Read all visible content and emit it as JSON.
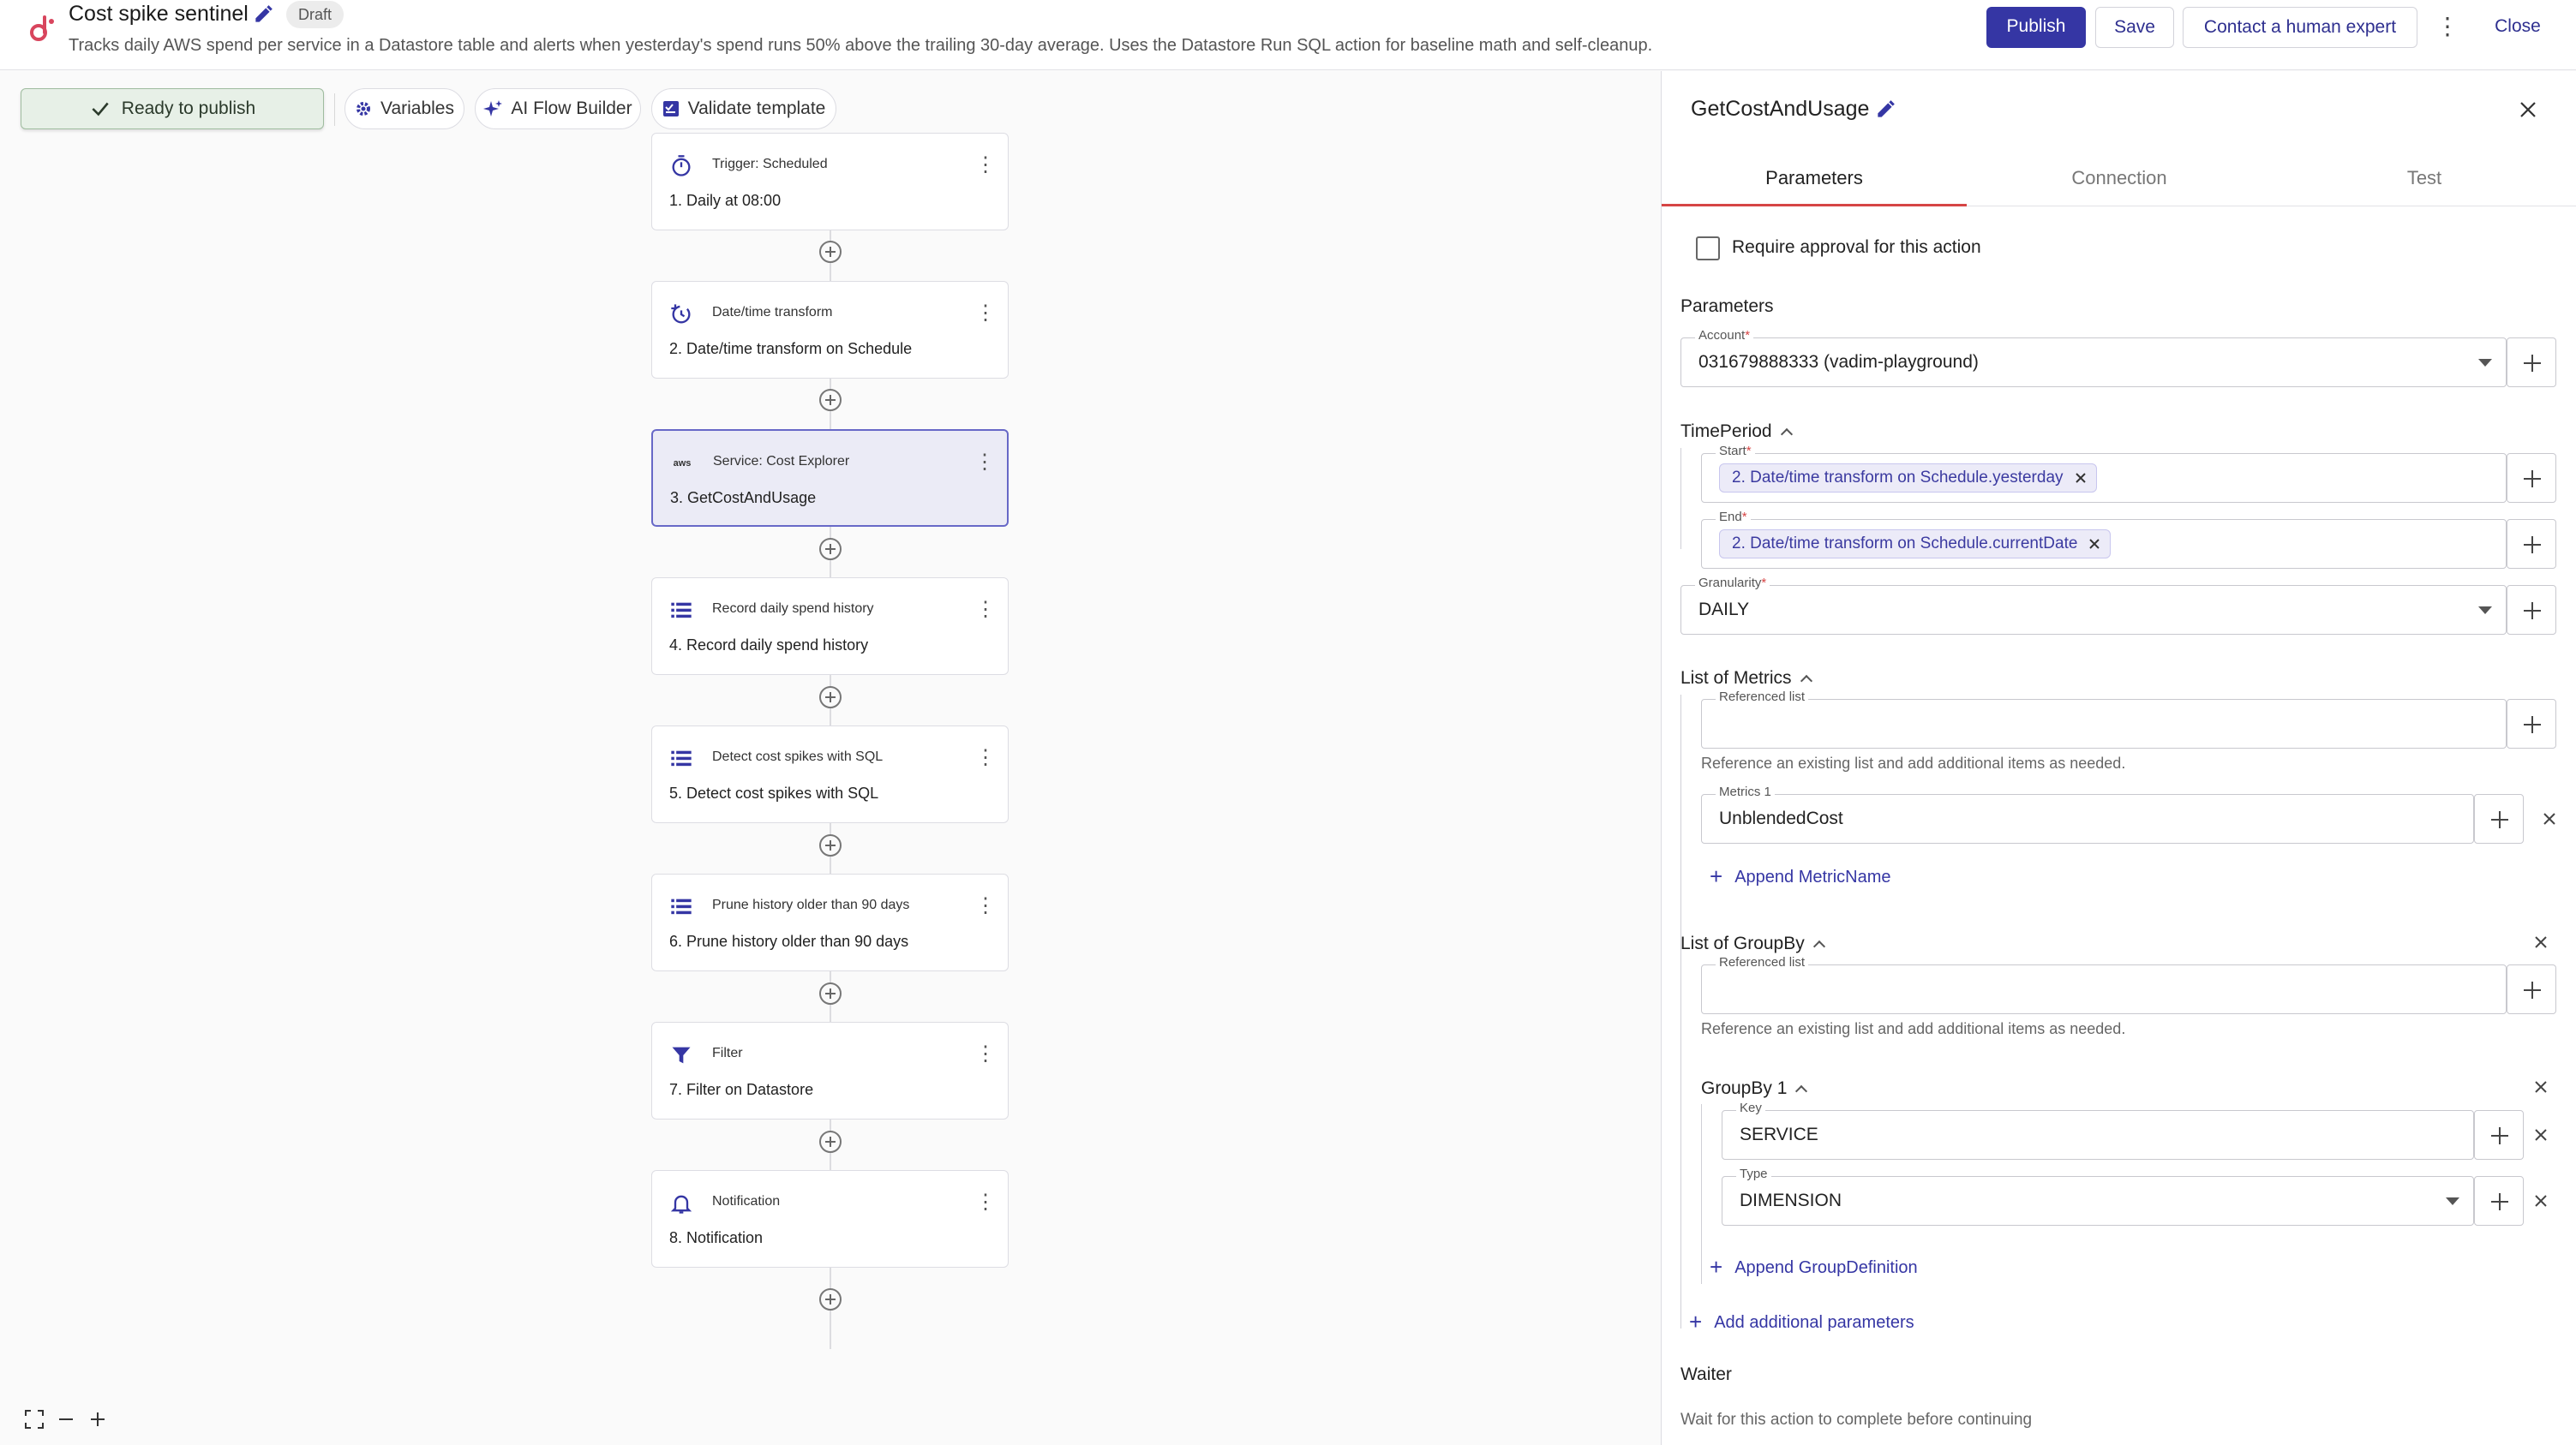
{
  "header": {
    "title": "Cost spike sentinel",
    "status_badge": "Draft",
    "description": "Tracks daily AWS spend per service in a Datastore table and alerts when yesterday's spend runs 50% above the trailing 30-day average. Uses the Datastore Run SQL action for baseline math and self-cleanup.",
    "publish_label": "Publish",
    "save_label": "Save",
    "contact_label": "Contact a human expert",
    "close_label": "Close"
  },
  "toolbar": {
    "ready_label": "Ready to publish",
    "variables_label": "Variables",
    "ai_builder_label": "AI Flow Builder",
    "validate_label": "Validate template"
  },
  "flow": {
    "nodes": [
      {
        "type": "Trigger: Scheduled",
        "label": "1. Daily at 08:00",
        "icon": "stopwatch-icon"
      },
      {
        "type": "Date/time transform",
        "label": "2. Date/time transform on Schedule",
        "icon": "clock-transform-icon"
      },
      {
        "type": "Service: Cost Explorer",
        "label": "3. GetCostAndUsage",
        "icon": "aws-icon",
        "selected": true
      },
      {
        "type": "Record daily spend history",
        "label": "4. Record daily spend history",
        "icon": "datastore-icon"
      },
      {
        "type": "Detect cost spikes with SQL",
        "label": "5. Detect cost spikes with SQL",
        "icon": "datastore-icon"
      },
      {
        "type": "Prune history older than 90 days",
        "label": "6. Prune history older than 90 days",
        "icon": "datastore-icon"
      },
      {
        "type": "Filter",
        "label": "7. Filter on Datastore",
        "icon": "filter-icon"
      },
      {
        "type": "Notification",
        "label": "8. Notification",
        "icon": "bell-icon"
      }
    ],
    "aws_badge_text": "aws"
  },
  "panel": {
    "title": "GetCostAndUsage",
    "tabs": [
      "Parameters",
      "Connection",
      "Test"
    ],
    "approval_label": "Require approval for this action",
    "parameters_heading": "Parameters",
    "account": {
      "label": "Account",
      "value": "031679888333 (vadim-playground)"
    },
    "time_period": {
      "heading": "TimePeriod",
      "start": {
        "label": "Start",
        "chip": "2. Date/time transform on Schedule.yesterday"
      },
      "end": {
        "label": "End",
        "chip": "2. Date/time transform on Schedule.currentDate"
      }
    },
    "granularity": {
      "label": "Granularity",
      "value": "DAILY"
    },
    "metrics": {
      "heading": "List of Metrics",
      "referenced_label": "Referenced list",
      "help": "Reference an existing list and add additional items as needed.",
      "item_label": "Metrics 1",
      "item_value": "UnblendedCost",
      "append_label": "Append MetricName"
    },
    "groupby": {
      "heading": "List of GroupBy",
      "referenced_label": "Referenced list",
      "help": "Reference an existing list and add additional items as needed.",
      "group_heading": "GroupBy 1",
      "key_label": "Key",
      "key_value": "SERVICE",
      "type_label": "Type",
      "type_value": "DIMENSION",
      "append_label": "Append GroupDefinition"
    },
    "add_params_label": "Add additional parameters",
    "waiter_heading": "Waiter",
    "waiter_desc": "Wait for this action to complete before continuing"
  },
  "colors": {
    "accent": "#3536a4",
    "tab_underline": "#d64545",
    "ready_bg": "#e7f0e7"
  }
}
